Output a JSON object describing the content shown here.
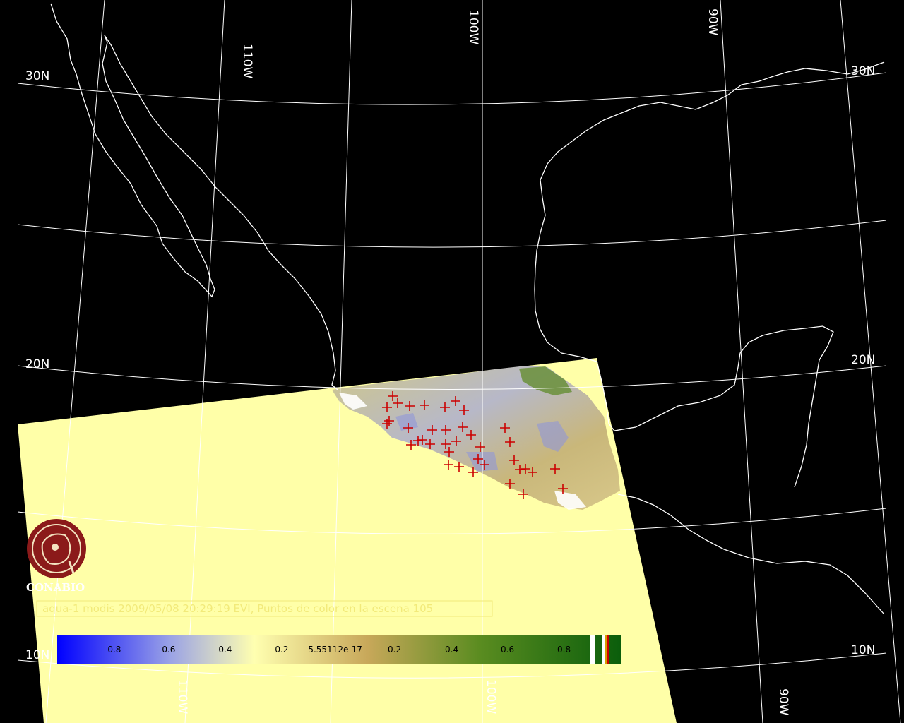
{
  "map": {
    "graticule_labels": {
      "lat_30_left": "30N",
      "lat_30_right": "30N",
      "lat_20_left": "20N",
      "lat_20_right": "20N",
      "lat_10_left": "10N",
      "lat_10_right": "10N",
      "lon_110_top": "110W",
      "lon_100_top": "100W",
      "lon_90_top": "90W",
      "lon_110_bottom": "110W",
      "lon_100_bottom": "100W",
      "lon_90_bottom": "90W"
    },
    "caption": "aqua-1 modis 2009/05/08 20:29:19 EVI, Puntos de color en la escena 105",
    "logo_text": "CONABIO",
    "colors": {
      "background": "#000000",
      "swath": "#ffffa8",
      "coastline": "#ffffff",
      "fire_marker": "#cc0000",
      "caption": "#f2ea7a"
    }
  },
  "colorbar": {
    "labels": [
      "-0.8",
      "-0.6",
      "-0.4",
      "-0.2",
      "-5.55112e-17",
      "0.2",
      "0.4",
      "0.6",
      "0.8"
    ],
    "gradient": [
      "#0000ff",
      "#9aa2e6",
      "#ffffb0",
      "#c8a85a",
      "#5a8c20",
      "#0b5e0b"
    ]
  }
}
